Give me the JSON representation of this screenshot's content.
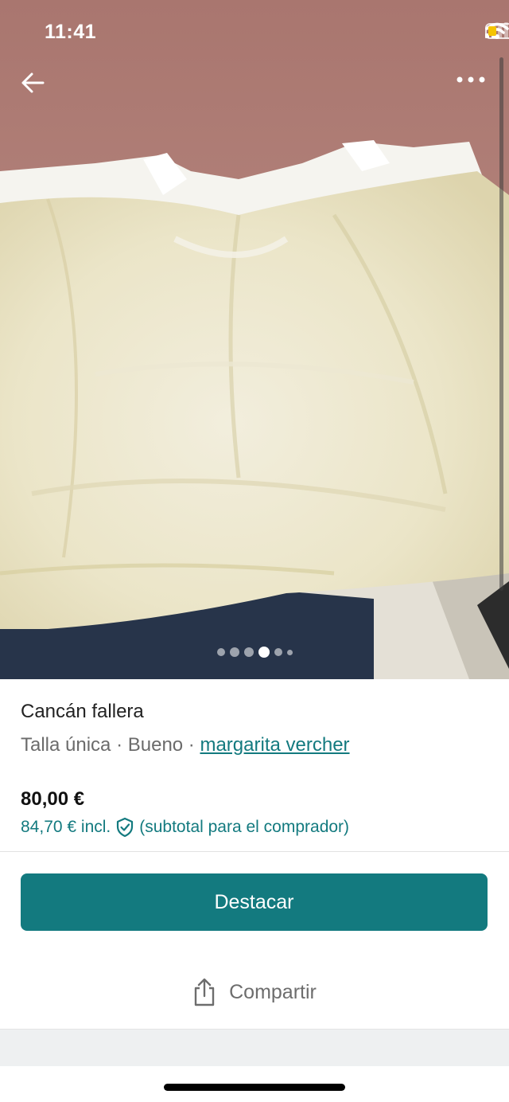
{
  "status_bar": {
    "time": "11:41"
  },
  "photo": {
    "carousel_total": 6,
    "carousel_active_index": 3
  },
  "product": {
    "title": "Cancán fallera",
    "size": "Talla única",
    "separator": " · ",
    "condition": "Bueno",
    "seller": "margarita vercher",
    "price": "80,00 €",
    "price_incl": "84,70 € incl.",
    "price_incl_note": "(subtotal para el comprador)"
  },
  "actions": {
    "primary_label": "Destacar",
    "share_label": "Compartir"
  },
  "colors": {
    "accent": "#137a7f",
    "text_primary": "#222222",
    "text_secondary": "#6b6b6b"
  },
  "icons": {
    "back": "arrow-left-icon",
    "more": "more-dots-icon",
    "shield": "shield-check-icon",
    "share": "share-icon",
    "signal": "signal-icon",
    "wifi": "wifi-icon",
    "battery": "battery-icon"
  }
}
